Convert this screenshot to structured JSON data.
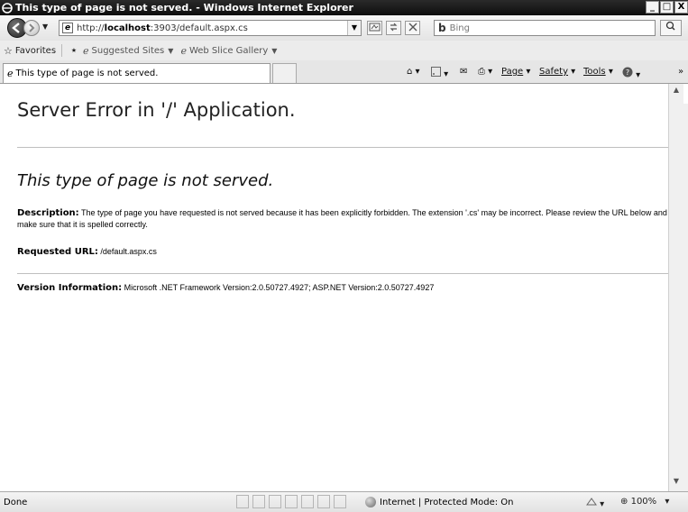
{
  "window": {
    "title": "This type of page is not served. - Windows Internet Explorer",
    "controls": [
      "_",
      "□",
      "X"
    ]
  },
  "address_bar": {
    "url_prefix": "http://",
    "url_host": "localhost",
    "url_rest": ":3903/default.aspx.cs"
  },
  "search": {
    "engine": "Bing",
    "placeholder": "Bing"
  },
  "favorites_bar": {
    "favorites_label": "Favorites",
    "suggested_sites": "Suggested Sites",
    "web_slice_gallery": "Web Slice Gallery"
  },
  "tab": {
    "title": "This type of page is not served."
  },
  "command_bar": {
    "page": "Page",
    "safety": "Safety",
    "tools": "Tools"
  },
  "page": {
    "heading": "Server Error in '/' Application.",
    "error_title": "This type of page is not served.",
    "description_label": "Description:",
    "description_text": " The type of page you have requested is not served because it has been explicitly forbidden.  The extension '.cs' may be incorrect.   Please review the URL below and make sure that it is spelled correctly.",
    "requested_url_label": "Requested URL:",
    "requested_url_value": " /default.aspx.cs",
    "version_label": "Version Information:",
    "version_value": " Microsoft .NET Framework Version:2.0.50727.4927; ASP.NET Version:2.0.50727.4927"
  },
  "status_bar": {
    "status": "Done",
    "zone": "Internet | Protected Mode: On",
    "zoom": "100%"
  }
}
